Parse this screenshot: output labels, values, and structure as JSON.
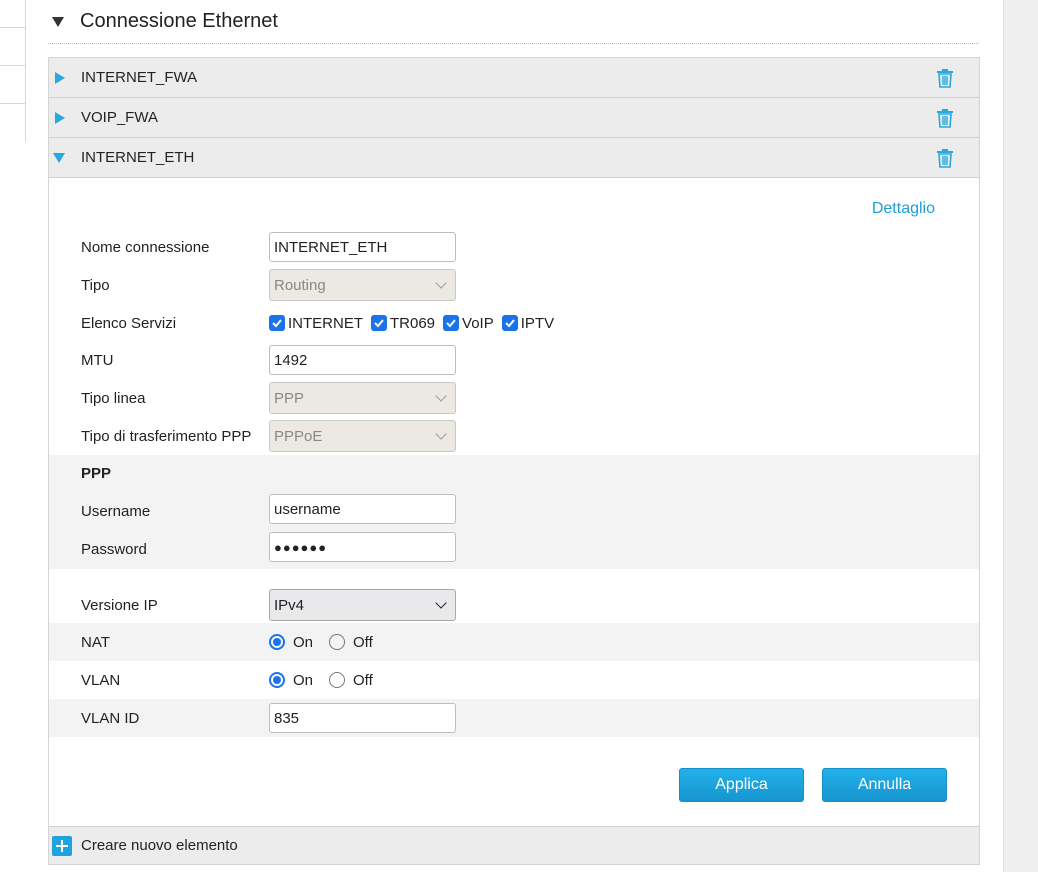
{
  "section": {
    "title": "Connessione Ethernet"
  },
  "connections": [
    {
      "name": "INTERNET_FWA",
      "expanded": false
    },
    {
      "name": "VOIP_FWA",
      "expanded": false
    },
    {
      "name": "INTERNET_ETH",
      "expanded": true
    }
  ],
  "icons": {
    "trash": "trash-icon",
    "expand": "triangle-right-icon",
    "collapse": "triangle-down-icon",
    "add": "plus-icon"
  },
  "colors": {
    "accent": "#1fa3dd",
    "control": "#1a73e8"
  },
  "detail_link": "Dettaglio",
  "form": {
    "nome_connessione": {
      "label": "Nome connessione",
      "value": "INTERNET_ETH"
    },
    "tipo": {
      "label": "Tipo",
      "value": "Routing"
    },
    "servizi": {
      "label": "Elenco Servizi",
      "items": [
        {
          "label": "INTERNET",
          "checked": true
        },
        {
          "label": "TR069",
          "checked": true
        },
        {
          "label": "VoIP",
          "checked": true
        },
        {
          "label": "IPTV",
          "checked": true
        }
      ]
    },
    "mtu": {
      "label": "MTU",
      "value": "1492"
    },
    "tipo_linea": {
      "label": "Tipo linea",
      "value": "PPP"
    },
    "tipo_trasferimento": {
      "label": "Tipo di trasferimento PPP",
      "value": "PPPoE"
    },
    "ppp_heading": "PPP",
    "username": {
      "label": "Username",
      "value": "username"
    },
    "password": {
      "label": "Password",
      "value": "●●●●●●"
    },
    "versione_ip": {
      "label": "Versione IP",
      "value": "IPv4"
    },
    "nat": {
      "label": "NAT",
      "on": "On",
      "off": "Off",
      "selected": "On"
    },
    "vlan": {
      "label": "VLAN",
      "on": "On",
      "off": "Off",
      "selected": "On"
    },
    "vlan_id": {
      "label": "VLAN ID",
      "value": "835"
    }
  },
  "buttons": {
    "apply": "Applica",
    "cancel": "Annulla"
  },
  "create_new": "Creare nuovo elemento"
}
